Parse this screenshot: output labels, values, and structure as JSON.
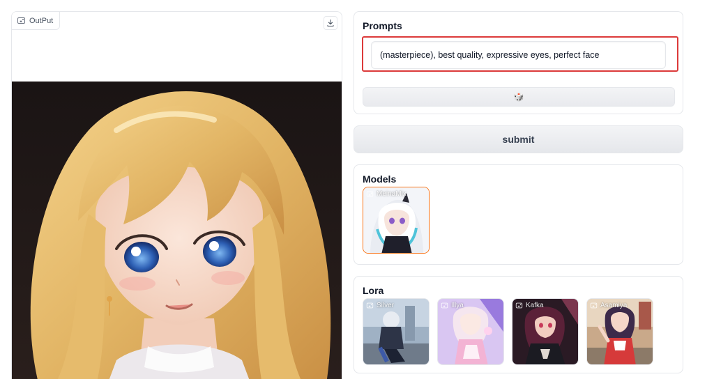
{
  "output": {
    "label": "OutPut",
    "download_icon": "download-icon",
    "image_icon": "image-icon"
  },
  "prompts": {
    "title": "Prompts",
    "input_value": "(masterpiece), best quality, expressive eyes, perfect face",
    "random_button_icon": "dice-icon",
    "random_button_glyph": "🎲",
    "highlight_color": "#dc3a3a"
  },
  "submit": {
    "label": "submit"
  },
  "models": {
    "title": "Models",
    "items": [
      {
        "label": "MeinaMix",
        "selected": true
      }
    ],
    "selected_color": "#f97316"
  },
  "lora": {
    "title": "Lora",
    "items": [
      {
        "label": "Silver"
      },
      {
        "label": "Illya"
      },
      {
        "label": "Kafka"
      },
      {
        "label": "Asamiya"
      }
    ]
  }
}
